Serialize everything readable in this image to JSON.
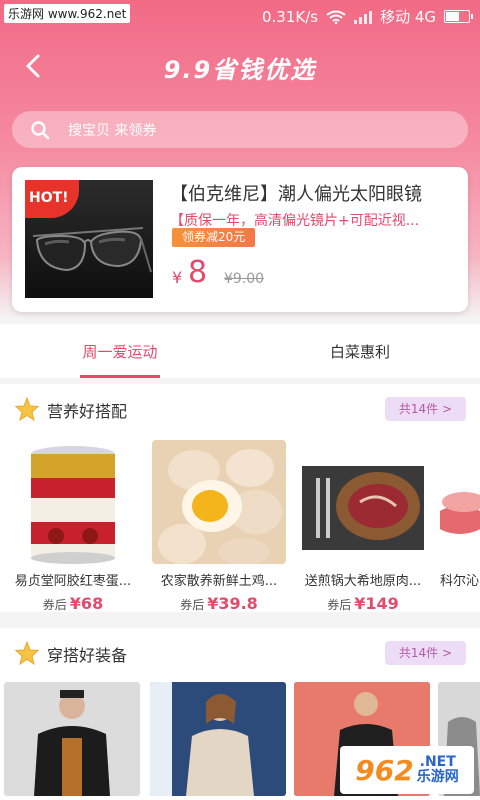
{
  "status_bar": {
    "watermark": "乐游网 www.962.net",
    "speed": "0.31K/s",
    "carrier": "移动 4G"
  },
  "header": {
    "title": "9.9省钱优选"
  },
  "search": {
    "placeholder": "搜宝贝 来领券"
  },
  "featured": {
    "badge": "HOT!",
    "title": "【伯克维尼】潮人偏光太阳眼镜",
    "desc": "【质保一年，高清偏光镜片+可配近视...",
    "coupon": "领券减20元",
    "currency": "¥",
    "price": "8",
    "original_price": "¥9.00"
  },
  "tabs": [
    {
      "label": "周一爱运动",
      "active": true
    },
    {
      "label": "白菜惠利",
      "active": false
    }
  ],
  "section1": {
    "title": "营养好搭配",
    "more": "共14件 >",
    "products": [
      {
        "name": "易贞堂阿胶红枣蛋...",
        "price_label": "券后",
        "price": "¥68"
      },
      {
        "name": "农家散养新鲜土鸡...",
        "price_label": "券后",
        "price": "¥39.8"
      },
      {
        "name": "送煎锅大希地原肉...",
        "price_label": "券后",
        "price": "¥149"
      },
      {
        "name": "科尔沁",
        "price_label": "",
        "price": ""
      }
    ]
  },
  "section2": {
    "title": "穿搭好装备",
    "more": "共14件 >"
  },
  "watermark_bottom": {
    "num": "962",
    "net": ".NET",
    "site": "乐游网"
  },
  "colors": {
    "accent": "#e34a6c",
    "header_top": "#f26a86",
    "coupon": "#f4774a"
  }
}
